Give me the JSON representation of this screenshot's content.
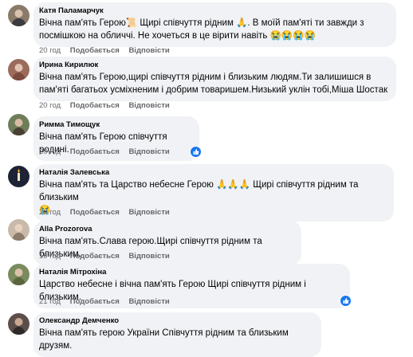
{
  "comments": [
    {
      "author": "Катя Паламарчук",
      "lines": [
        "Вічна пам'ять Герою📜 Щирі співчуття рідним 🙏. В моїй пам'яті ти завжди з",
        "посмішкою на обличчі. Не хочеться в це вірити навіть 😭😭😭😭"
      ],
      "time": "20 год",
      "like_label": "Подобається",
      "reply_label": "Відповісти",
      "avatar_color": "#8a7a6a"
    },
    {
      "author": "Ирина Кирилюк",
      "lines": [
        "Вічна пам'ять Герою,щирі співчуття рідним і близьким людям.Ти залишишся в",
        "пам'яті багатьох усміхненим і добрим товаришем.Низький уклін тобі,Міша Шостак"
      ],
      "time": "20 год",
      "like_label": "Подобається",
      "reply_label": "Відповісти",
      "avatar_color": "#9b6b5c"
    },
    {
      "author": "Римма Тимощук",
      "lines": [
        "Вічна пам'ять Герою співчуття родині."
      ],
      "time": "20 год",
      "like_label": "Подобається",
      "reply_label": "Відповісти",
      "avatar_color": "#6f7d5a"
    },
    {
      "author": "Наталія Залевська",
      "lines": [
        "Вічна пам'ять та Царство небесне Герою 🙏🙏🙏 Щирі співчуття рідним та близьким",
        "😭"
      ],
      "time": "20 год",
      "like_label": "Подобається",
      "reply_label": "Відповісти",
      "avatar_color": "#1e2235"
    },
    {
      "author": "Alla Prozorova",
      "lines": [
        "Вічна пам'ять.Слава герою.Щирі співчуття рідним та близьким."
      ],
      "time": "19 год",
      "like_label": "Подобається",
      "reply_label": "Відповісти",
      "avatar_color": "#c9b9a8"
    },
    {
      "author": "Наталія Мітрохіна",
      "lines": [
        "Царство небесне і вічна пам'ять Герою Щирі співчуття рідним і близьким."
      ],
      "time": "21 год",
      "like_label": "Подобається",
      "reply_label": "Відповісти",
      "avatar_color": "#7a8c5e"
    },
    {
      "author": "Олександр Демченко",
      "lines": [
        "Вічна пам'ять герою України Співчуття рідним та близьким друзям."
      ],
      "time": "",
      "like_label": "",
      "reply_label": "",
      "avatar_color": "#5c4e4a"
    }
  ],
  "colors": {
    "bubble": "#f0f2f5",
    "meta_text": "#65676b",
    "like_badge": "#1877f2"
  },
  "icons": {
    "like_reaction": "thumbs-up-icon"
  }
}
